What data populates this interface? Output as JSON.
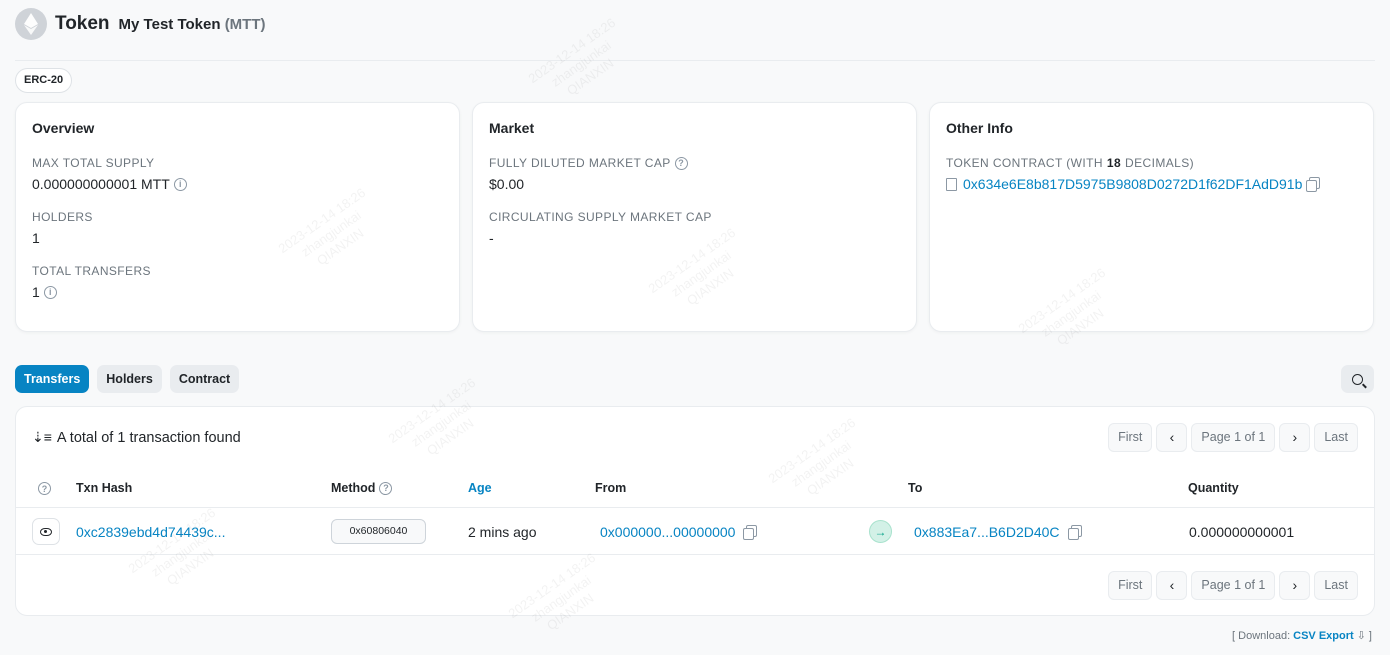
{
  "header": {
    "title": "Token",
    "token_name": "My Test Token",
    "token_symbol": "(MTT)"
  },
  "badge": "ERC-20",
  "overview": {
    "heading": "Overview",
    "max_supply_label": "MAX TOTAL SUPPLY",
    "max_supply_value": "0.000000000001 MTT",
    "holders_label": "HOLDERS",
    "holders_value": "1",
    "transfers_label": "TOTAL TRANSFERS",
    "transfers_value": "1"
  },
  "market": {
    "heading": "Market",
    "fdmc_label": "FULLY DILUTED MARKET CAP",
    "fdmc_value": "$0.00",
    "csmc_label": "CIRCULATING SUPPLY MARKET CAP",
    "csmc_value": "-"
  },
  "other_info": {
    "heading": "Other Info",
    "contract_label_pre": "TOKEN CONTRACT (WITH",
    "contract_label_decimals": "18",
    "contract_label_post": "DECIMALS)",
    "contract_address": "0x634e6E8b817D5975B9808D0272D1f62DF1AdD91b"
  },
  "tabs": [
    {
      "label": "Transfers",
      "active": true
    },
    {
      "label": "Holders",
      "active": false
    },
    {
      "label": "Contract",
      "active": false
    }
  ],
  "table": {
    "summary": "A total of 1 transaction found",
    "pager": {
      "first": "First",
      "prev": "‹",
      "page": "Page 1 of 1",
      "next": "›",
      "last": "Last"
    },
    "headers": {
      "txn_hash": "Txn Hash",
      "method": "Method",
      "age": "Age",
      "from": "From",
      "to": "To",
      "quantity": "Quantity"
    },
    "rows": [
      {
        "txn_hash": "0xc2839ebd4d74439c...",
        "method": "0x60806040",
        "age": "2 mins ago",
        "from": "0x000000...00000000",
        "to": "0x883Ea7...B6D2D40C",
        "quantity": "0.000000000001"
      }
    ]
  },
  "download": {
    "prefix": "[ Download:",
    "link": "CSV Export",
    "suffix": "⇩ ]"
  },
  "watermark": {
    "date": "2023-12-14 18:26",
    "user": "zhangjunkai",
    "org": "QIANXIN"
  },
  "colors": {
    "accent": "#0784c3",
    "success": "#00a186"
  }
}
